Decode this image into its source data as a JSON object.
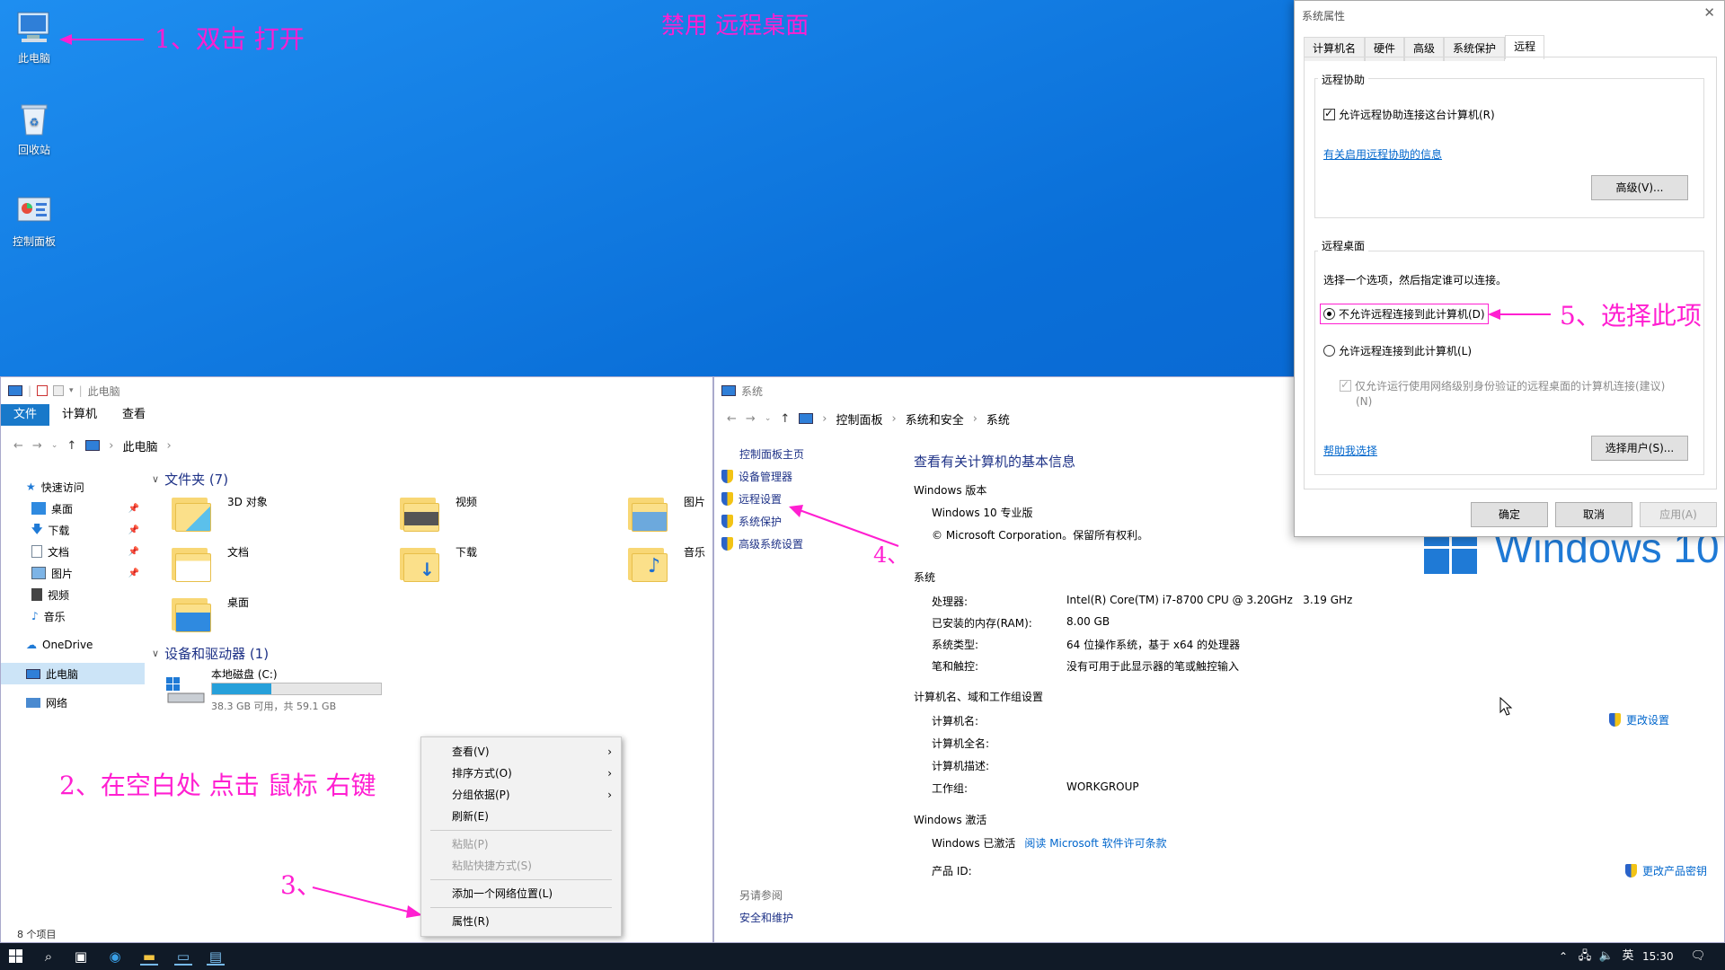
{
  "page_title": "禁用 远程桌面",
  "desktop": {
    "icons": [
      {
        "label": "此电脑"
      },
      {
        "label": "回收站"
      },
      {
        "label": "控制面板"
      }
    ]
  },
  "annotations": {
    "step1": "1、双击 打开",
    "step2": "2、在空白处 点击 鼠标 右键",
    "step3": "3、",
    "step4": "4、",
    "step5": "5、选择此项"
  },
  "explorer": {
    "title": "此电脑",
    "tabs": [
      "文件",
      "计算机",
      "查看"
    ],
    "breadcrumb": "此电脑",
    "nav": {
      "quick_access": "快速访问",
      "quick_items": [
        "桌面",
        "下载",
        "文档",
        "图片",
        "视频",
        "音乐"
      ],
      "onedrive": "OneDrive",
      "this_pc": "此电脑",
      "network": "网络"
    },
    "folders_header": "文件夹 (7)",
    "folders": [
      "3D 对象",
      "视频",
      "图片",
      "文档",
      "下载",
      "音乐",
      "桌面"
    ],
    "drives_header": "设备和驱动器 (1)",
    "drive": {
      "name": "本地磁盘 (C:)",
      "free": "38.3 GB 可用，共 59.1 GB",
      "used_fraction": 0.35
    },
    "status": "8 个项目"
  },
  "context_menu": {
    "items": [
      {
        "label": "查看(V)",
        "submenu": true,
        "disabled": false
      },
      {
        "label": "排序方式(O)",
        "submenu": true,
        "disabled": false
      },
      {
        "label": "分组依据(P)",
        "submenu": true,
        "disabled": false
      },
      {
        "label": "刷新(E)",
        "submenu": false,
        "disabled": false
      },
      {
        "label": "粘贴(P)",
        "submenu": false,
        "disabled": true
      },
      {
        "label": "粘贴快捷方式(S)",
        "submenu": false,
        "disabled": true
      },
      {
        "label": "添加一个网络位置(L)",
        "submenu": false,
        "disabled": false
      },
      {
        "label": "属性(R)",
        "submenu": false,
        "disabled": false
      }
    ]
  },
  "system_window": {
    "title": "系统",
    "breadcrumb": [
      "控制面板",
      "系统和安全",
      "系统"
    ],
    "left_links": {
      "home": "控制面板主页",
      "items": [
        "设备管理器",
        "远程设置",
        "系统保护",
        "高级系统设置"
      ],
      "see_also": "另请参阅",
      "security": "安全和维护"
    },
    "heading": "查看有关计算机的基本信息",
    "edition_hd": "Windows 版本",
    "edition": "Windows 10 专业版",
    "copyright": "© Microsoft Corporation。保留所有权利。",
    "win_logo": "Windows 10",
    "system_hd": "系统",
    "system_rows": [
      {
        "k": "处理器:",
        "v": "Intel(R) Core(TM) i7-8700 CPU @ 3.20GHz   3.19 GHz"
      },
      {
        "k": "已安装的内存(RAM):",
        "v": "8.00 GB"
      },
      {
        "k": "系统类型:",
        "v": "64 位操作系统，基于 x64 的处理器"
      },
      {
        "k": "笔和触控:",
        "v": "没有可用于此显示器的笔或触控输入"
      }
    ],
    "name_hd": "计算机名、域和工作组设置",
    "name_rows": [
      {
        "k": "计算机名:",
        "v": ""
      },
      {
        "k": "计算机全名:",
        "v": ""
      },
      {
        "k": "计算机描述:",
        "v": ""
      },
      {
        "k": "工作组:",
        "v": "WORKGROUP"
      }
    ],
    "change_settings": "更改设置",
    "activation_hd": "Windows 激活",
    "activated": "Windows 已激活",
    "license_link": "阅读 Microsoft 软件许可条款",
    "product_id": "产品 ID:",
    "change_key": "更改产品密钥"
  },
  "sys_props": {
    "title": "系统属性",
    "tabs": [
      "计算机名",
      "硬件",
      "高级",
      "系统保护",
      "远程"
    ],
    "ra_group": "远程协助",
    "ra_checkbox": "允许远程协助连接这台计算机(R)",
    "ra_link": "有关启用远程协助的信息",
    "advanced_btn": "高级(V)...",
    "rd_group": "远程桌面",
    "rd_hint": "选择一个选项，然后指定谁可以连接。",
    "opt_deny": "不允许远程连接到此计算机(D)",
    "opt_allow": "允许远程连接到此计算机(L)",
    "nla_line1": "仅允许运行使用网络级别身份验证的远程桌面的计算机连接(建议)",
    "nla_line2": "(N)",
    "help_link": "帮助我选择",
    "select_users_btn": "选择用户(S)...",
    "ok": "确定",
    "cancel": "取消",
    "apply": "应用(A)"
  },
  "taskbar": {
    "ime": "英",
    "time": "15:30"
  },
  "colors": {
    "annotation": "#ff1fd1",
    "link": "#0066cc",
    "accent": "#1979ca"
  }
}
